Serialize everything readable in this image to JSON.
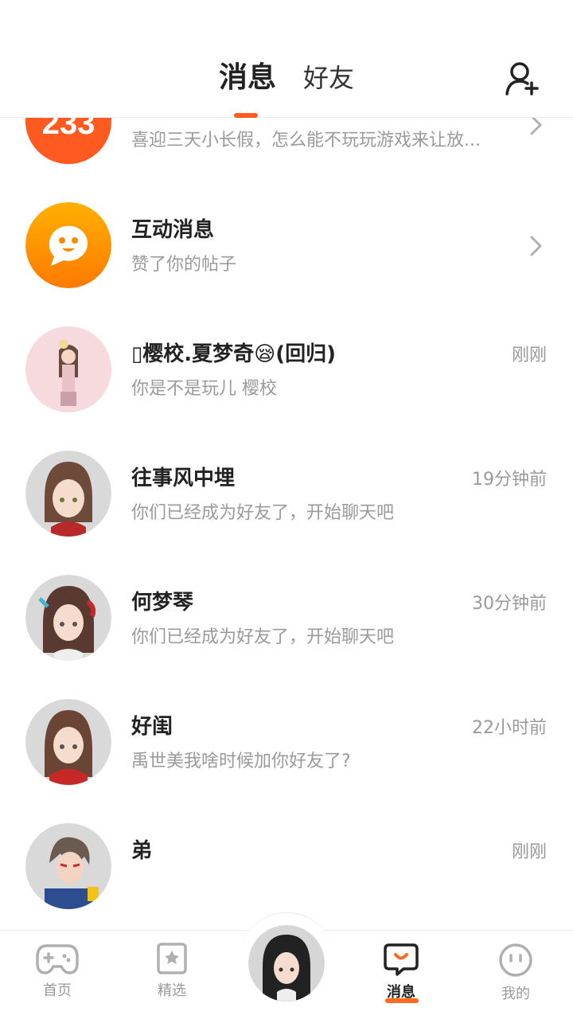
{
  "header": {
    "tabs": [
      {
        "label": "消息",
        "active": true
      },
      {
        "label": "好友",
        "active": false
      }
    ],
    "add_friend_icon": "add-friend-icon"
  },
  "conversations": [
    {
      "title": "",
      "subtitle": "喜迎三天小长假，怎么能不玩玩游戏来让放...",
      "time": "",
      "chevron": true,
      "avatar_text": "233"
    },
    {
      "title": "互动消息",
      "subtitle": "赞了你的帖子",
      "time": "",
      "chevron": true
    },
    {
      "title": "▯樱校.夏梦奇😪(回归)",
      "subtitle": "你是不是玩儿 樱校",
      "time": "刚刚"
    },
    {
      "title": "往事风中埋",
      "subtitle": "你们已经成为好友了，开始聊天吧",
      "time": "19分钟前"
    },
    {
      "title": "何梦琴",
      "subtitle": "你们已经成为好友了，开始聊天吧",
      "time": "30分钟前"
    },
    {
      "title": "好闺",
      "subtitle": "禹世美我啥时候加你好友了?",
      "time": "22小时前"
    },
    {
      "title": "弟",
      "subtitle": "",
      "time": "刚刚"
    }
  ],
  "bottom_nav": {
    "items": [
      {
        "label": "首页",
        "icon": "gamepad-icon",
        "active": false
      },
      {
        "label": "精选",
        "icon": "star-bookmark-icon",
        "active": false
      },
      {
        "label": "消息",
        "icon": "message-bubble-icon",
        "active": true
      },
      {
        "label": "我的",
        "icon": "face-icon",
        "active": false
      }
    ]
  },
  "colors": {
    "accent": "#ff5a1f",
    "orange_gradient_start": "#ffb000",
    "orange_gradient_end": "#ff7a00",
    "muted_text": "#9a9a9a"
  }
}
